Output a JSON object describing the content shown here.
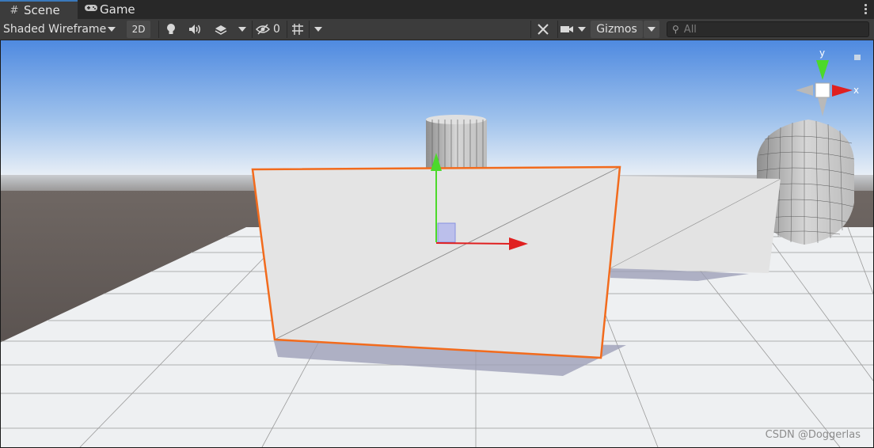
{
  "tabs": [
    {
      "label": "Scene",
      "icon": "grid-icon",
      "active": true
    },
    {
      "label": "Game",
      "icon": "gamepad-icon",
      "active": false
    }
  ],
  "toolbar": {
    "draw_mode": "Shaded Wireframe",
    "mode_2d": "2D",
    "hidden_count": "0",
    "gizmos_label": "Gizmos",
    "search_placeholder": "All"
  },
  "gizmo_axes": {
    "y": "y",
    "x": "x"
  },
  "watermark": "CSDN @Doggerlas",
  "colors": {
    "selection_outline": "#f26b1d",
    "axis_x": "#e02020",
    "axis_y": "#4cd92a",
    "axis_z": "#5060e0",
    "active_tab_accent": "#3a79bb"
  }
}
